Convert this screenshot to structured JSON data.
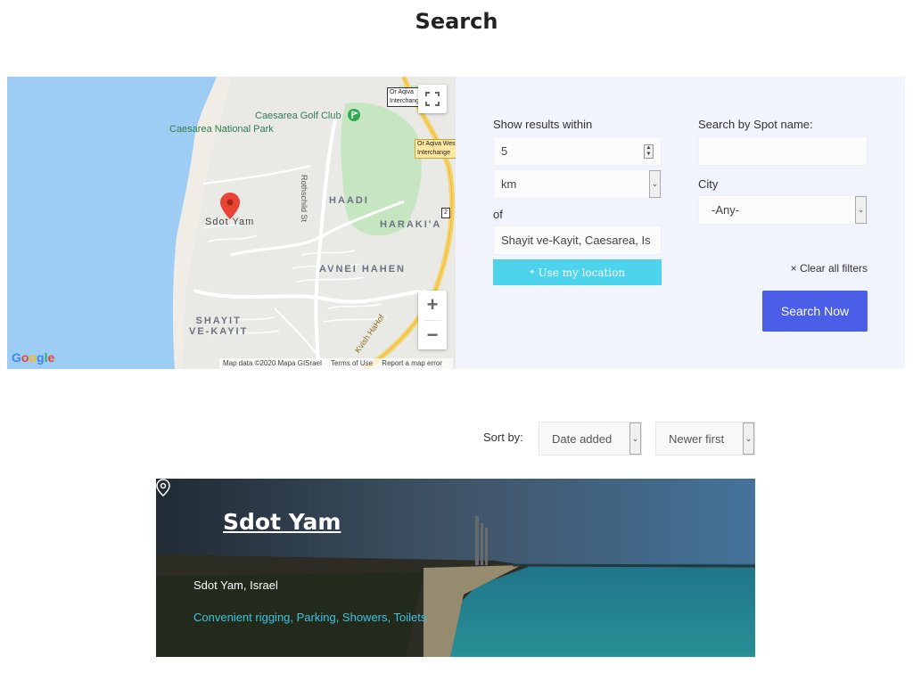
{
  "page": {
    "title": "Search"
  },
  "map": {
    "labels": {
      "caesarea_golf_club": "Caesarea Golf Club",
      "caesarea_national_park": "Caesarea National Park",
      "or_aqiva_interchange_top": "Or Aqiva\nInterchange",
      "or_aqiva_west_interchange": "Or Aqiva West\nInterchange",
      "rothschild_st": "Rothschild St",
      "haadi": "HAADI",
      "haraki_a": "HARAKI'A",
      "sdot_yam": "Sdot Yam",
      "avnei_hahen": "AVNEI HAHEN",
      "shayit_ve_kayit": "SHAYIT\nVE-KAYIT",
      "kvish_hahof": "Kvish HaHof",
      "road_shield": "2"
    },
    "zoom_in": "+",
    "zoom_out": "−",
    "google_logo": "Google",
    "attribution": {
      "map_data": "Map data ©2020 Mapa GISrael",
      "terms": "Terms of Use",
      "report": "Report a map error"
    }
  },
  "search_panel": {
    "radius_label": "Show results within",
    "radius_value": "5",
    "unit_value": "km",
    "of_label": "of",
    "location_value": "Shayit ve-Kayit, Caesarea, Is",
    "use_location_label": "Use my location",
    "spot_name_label": "Search by Spot name:",
    "spot_name_value": "",
    "city_label": "City",
    "city_value": "-Any-",
    "clear_filters_label": "× Clear all filters",
    "search_button_label": "Search Now"
  },
  "sort": {
    "label": "Sort by:",
    "field_value": "Date added",
    "order_value": "Newer first"
  },
  "results": [
    {
      "title": "Sdot Yam",
      "location": "Sdot Yam, Israel",
      "amenities": "Convenient rigging, Parking, Showers, Toilets"
    }
  ],
  "colors": {
    "accent_button": "#4a5ee7",
    "location_button": "#4dd4ec",
    "panel_bg": "#f2f4fd",
    "amenities_link": "#3ec3e0",
    "map_marker": "#ea4335"
  },
  "icons": {
    "map_marker": "map-pin-icon",
    "fullscreen": "fullscreen-icon",
    "golf": "golf-icon",
    "location_pin": "location-pin-icon"
  }
}
